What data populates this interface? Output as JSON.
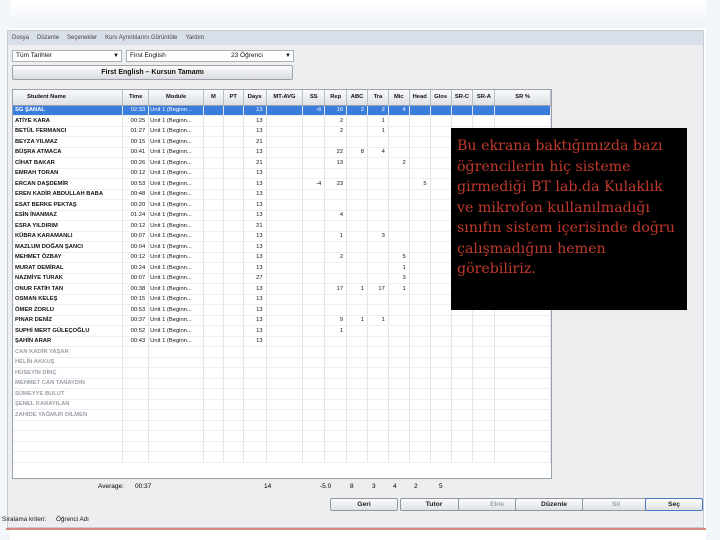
{
  "menu": [
    "Dosya",
    "Düzenle",
    "Seçenekler",
    "Kurs Ayrıntılarını Görüntüle",
    "Yardım"
  ],
  "filters": {
    "date_range": "Tüm Tarihler",
    "course": "First English",
    "student_count": "23 Öğrenci"
  },
  "title_button": "First English  –  Kursun Tamamı",
  "columns": [
    "Student Name",
    "Time",
    "Module",
    "M",
    "PT",
    "Days",
    "MT-AVG",
    "SS",
    "Rep",
    "ABC",
    "Tra",
    "Mic",
    "Head",
    "Glos",
    "SR-C",
    "SR-A",
    "SR %"
  ],
  "rows": [
    {
      "name": "SG ŞANAL",
      "time": "02:33",
      "module": "Unit 1 (Beginn...",
      "days": "13",
      "ss": "-6",
      "rep": "10",
      "abc": "2",
      "tra": "2",
      "mic": "4",
      "head": "",
      "selected": true
    },
    {
      "name": "ATİYE KARA",
      "time": "00:25",
      "module": "Unit 1 (Beginn...",
      "days": "13",
      "ss": "",
      "rep": "2",
      "abc": "",
      "tra": "1",
      "mic": "",
      "head": ""
    },
    {
      "name": "BETÜL FERMANCI",
      "time": "01:27",
      "module": "Unit 1 (Beginn...",
      "days": "13",
      "ss": "",
      "rep": "2",
      "abc": "",
      "tra": "1",
      "mic": "",
      "head": ""
    },
    {
      "name": "BEYZA YILMAZ",
      "time": "00:15",
      "module": "Unit 1 (Beginn...",
      "days": "21",
      "ss": "",
      "rep": "",
      "abc": "",
      "tra": "",
      "mic": "",
      "head": ""
    },
    {
      "name": "BÜŞRA ATMACA",
      "time": "00:41",
      "module": "Unit 1 (Beginn...",
      "days": "13",
      "ss": "",
      "rep": "22",
      "abc": "8",
      "tra": "4",
      "mic": "",
      "head": ""
    },
    {
      "name": "CİHAT BAKAR",
      "time": "00:26",
      "module": "Unit 1 (Beginn...",
      "days": "21",
      "ss": "",
      "rep": "13",
      "abc": "",
      "tra": "",
      "mic": "2",
      "head": ""
    },
    {
      "name": "EMRAH TORAN",
      "time": "00:12",
      "module": "Unit 1 (Beginn...",
      "days": "13",
      "ss": "",
      "rep": "",
      "abc": "",
      "tra": "",
      "mic": "",
      "head": ""
    },
    {
      "name": "ERCAN DAŞDEMİR",
      "time": "00:53",
      "module": "Unit 1 (Beginn...",
      "days": "13",
      "ss": "-4",
      "rep": "23",
      "abc": "",
      "tra": "",
      "mic": "",
      "head": "5"
    },
    {
      "name": "EREN KADİR ABDULLAH BABA",
      "time": "00:48",
      "module": "Unit 1 (Beginn...",
      "days": "13",
      "ss": "",
      "rep": "",
      "abc": "",
      "tra": "",
      "mic": "",
      "head": ""
    },
    {
      "name": "ESAT BERKE PEKTAŞ",
      "time": "00:20",
      "module": "Unit 1 (Beginn...",
      "days": "13",
      "ss": "",
      "rep": "",
      "abc": "",
      "tra": "",
      "mic": "",
      "head": ""
    },
    {
      "name": "ESİN İNANMAZ",
      "time": "01:24",
      "module": "Unit 1 (Beginn...",
      "days": "13",
      "ss": "",
      "rep": "4",
      "abc": "",
      "tra": "",
      "mic": "",
      "head": ""
    },
    {
      "name": "ESRA YILDIRIM",
      "time": "00:12",
      "module": "Unit 1 (Beginn...",
      "days": "21",
      "ss": "",
      "rep": "",
      "abc": "",
      "tra": "",
      "mic": "",
      "head": ""
    },
    {
      "name": "KÜBRA KARAMANLI",
      "time": "00:07",
      "module": "Unit 1 (Beginn...",
      "days": "13",
      "ss": "",
      "rep": "1",
      "abc": "",
      "tra": "3",
      "mic": "",
      "head": ""
    },
    {
      "name": "MAZLUM DOĞAN ŞANCI",
      "time": "00:04",
      "module": "Unit 1 (Beginn...",
      "days": "13",
      "ss": "",
      "rep": "",
      "abc": "",
      "tra": "",
      "mic": "",
      "head": ""
    },
    {
      "name": "MEHMET ÖZBAY",
      "time": "00:12",
      "module": "Unit 1 (Beginn...",
      "days": "13",
      "ss": "",
      "rep": "2",
      "abc": "",
      "tra": "",
      "mic": "5",
      "head": ""
    },
    {
      "name": "MURAT DEMİRAL",
      "time": "00:24",
      "module": "Unit 1 (Beginn...",
      "days": "13",
      "ss": "",
      "rep": "",
      "abc": "",
      "tra": "",
      "mic": "1",
      "head": ""
    },
    {
      "name": "NAZMİYE TURAK",
      "time": "00:07",
      "module": "Unit 1 (Beginn...",
      "days": "27",
      "ss": "",
      "rep": "",
      "abc": "",
      "tra": "",
      "mic": "3",
      "head": ""
    },
    {
      "name": "ONUR FATİH TAN",
      "time": "00:38",
      "module": "Unit 1 (Beginn...",
      "days": "13",
      "ss": "",
      "rep": "17",
      "abc": "1",
      "tra": "17",
      "mic": "1",
      "head": ""
    },
    {
      "name": "OSMAN KELEŞ",
      "time": "00:15",
      "module": "Unit 1 (Beginn...",
      "days": "13",
      "ss": "",
      "rep": "",
      "abc": "",
      "tra": "",
      "mic": "",
      "head": ""
    },
    {
      "name": "ÖMER ZORLU",
      "time": "00:53",
      "module": "Unit 1 (Beginn...",
      "days": "13",
      "ss": "",
      "rep": "",
      "abc": "",
      "tra": "",
      "mic": "",
      "head": ""
    },
    {
      "name": "PINAR DENİZ",
      "time": "00:37",
      "module": "Unit 1 (Beginn...",
      "days": "13",
      "ss": "",
      "rep": "9",
      "abc": "1",
      "tra": "1",
      "mic": "",
      "head": ""
    },
    {
      "name": "SUPHİ MERT GÜLEÇOĞLU",
      "time": "00:52",
      "module": "Unit 1 (Beginn...",
      "days": "13",
      "ss": "",
      "rep": "1",
      "abc": "",
      "tra": "",
      "mic": "",
      "head": ""
    },
    {
      "name": "ŞAHİN ARAR",
      "time": "00:43",
      "module": "Unit 1 (Beginn...",
      "days": "13",
      "ss": "",
      "rep": "",
      "abc": "",
      "tra": "",
      "mic": "",
      "head": ""
    },
    {
      "name": "CAN KADİR YAŞAR",
      "dim": true
    },
    {
      "name": "HELİN AKKUŞ",
      "dim": true
    },
    {
      "name": "HÜSEYİN DİNÇ",
      "dim": true
    },
    {
      "name": "MEHMET CAN TANAYDIN",
      "dim": true
    },
    {
      "name": "SÜMEYYE BULUT",
      "dim": true
    },
    {
      "name": "ŞENEL KARAYILAN",
      "dim": true
    },
    {
      "name": "ZAHİDE YAĞMUR DİLMEN",
      "dim": true
    }
  ],
  "average": {
    "label": "Average:",
    "time": "00:37",
    "days": "14",
    "ss": "-5.0",
    "rep": "8",
    "abc": "3",
    "tra": "4",
    "mic": "2",
    "head": "5"
  },
  "buttons": {
    "back": "Geri",
    "tutor": "Tutor",
    "add": "Ekle",
    "edit": "Düzenle",
    "delete": "Sil",
    "select": "Seç"
  },
  "sort": {
    "label": "Sıralama kriteri:",
    "value": "Öğrenci Adı"
  },
  "callout": "Bu ekrana baktığımızda bazı öğrencilerin hiç sisteme girmediği BT lab.da Kulaklık ve mikrofon kullanılmadığı sınıfın sistem içerisinde doğru çalışmadığını hemen görebiliriz.",
  "colors": {
    "selected_row": "#3b7ddd",
    "callout_bg": "#000000",
    "callout_text": "#c0392b"
  }
}
